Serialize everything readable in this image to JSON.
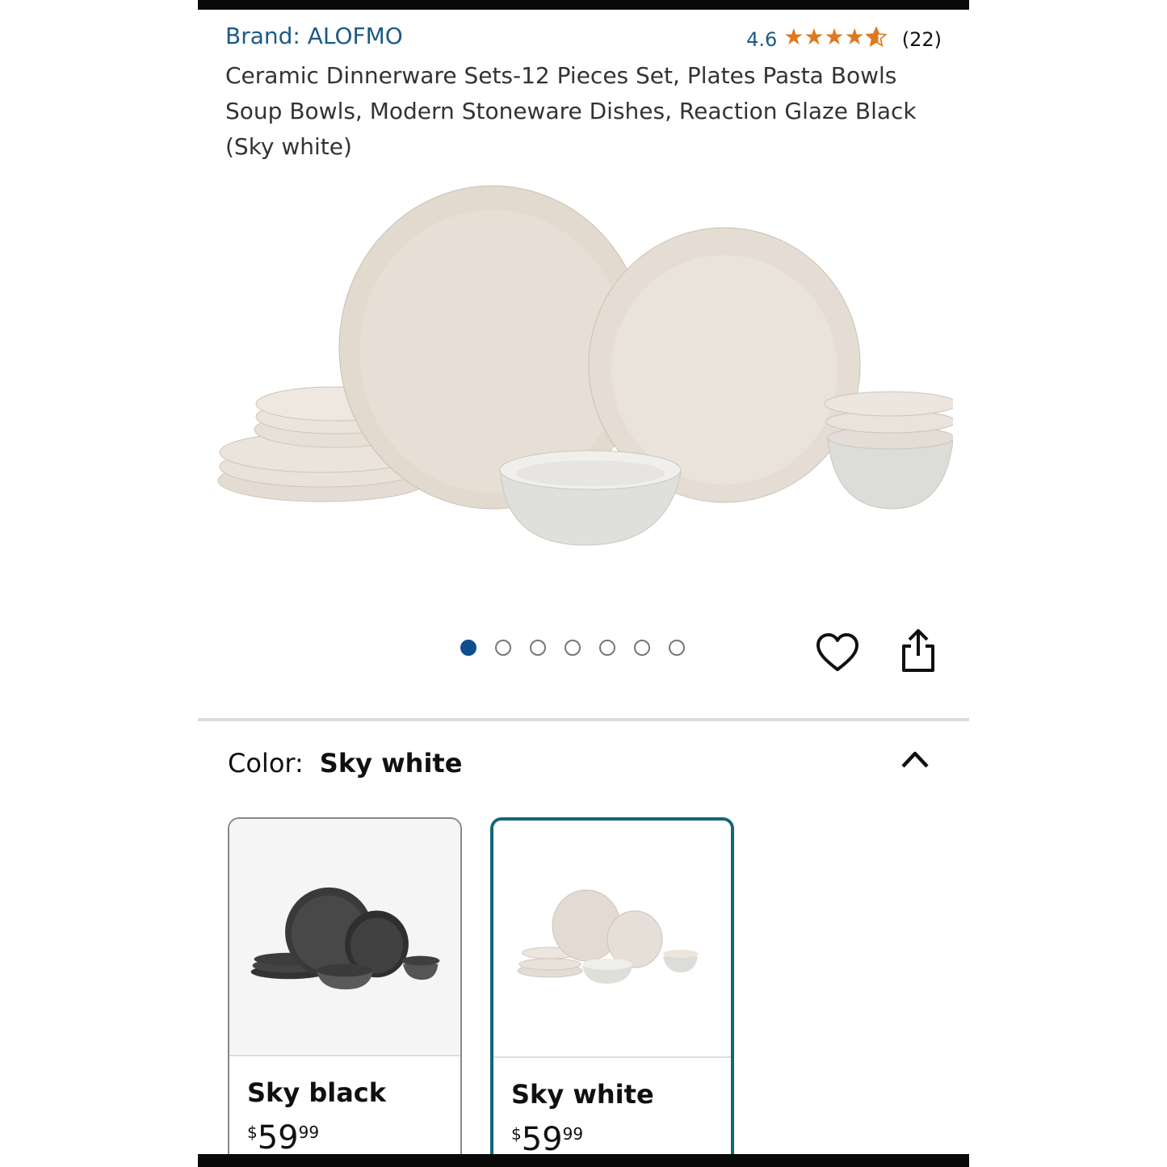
{
  "product": {
    "brand": "Brand: ALOFMO",
    "rating_value": "4.6",
    "rating_stars": 4.6,
    "rating_count": "(22)",
    "title": "Ceramic Dinnerware Sets-12 Pieces Set, Plates Pasta Bowls Soup Bowls, Modern Stoneware Dishes, Reaction Glaze Black (Sky white)"
  },
  "gallery": {
    "image_count": 7,
    "active_index": 0
  },
  "icons": {
    "wishlist": "heart-icon",
    "share": "share-icon",
    "collapse": "chevron-up-icon"
  },
  "color_selector": {
    "label": "Color:",
    "selected": "Sky white",
    "options": [
      {
        "name": "Sky black",
        "price_symbol": "$",
        "price_whole": "59",
        "price_fraction": "99"
      },
      {
        "name": "Sky white",
        "price_symbol": "$",
        "price_whole": "59",
        "price_fraction": "99"
      }
    ]
  },
  "colors": {
    "link": "#1b5b85",
    "star": "#de7921",
    "selected_border": "#146679",
    "active_dot": "#0f4e8c"
  }
}
